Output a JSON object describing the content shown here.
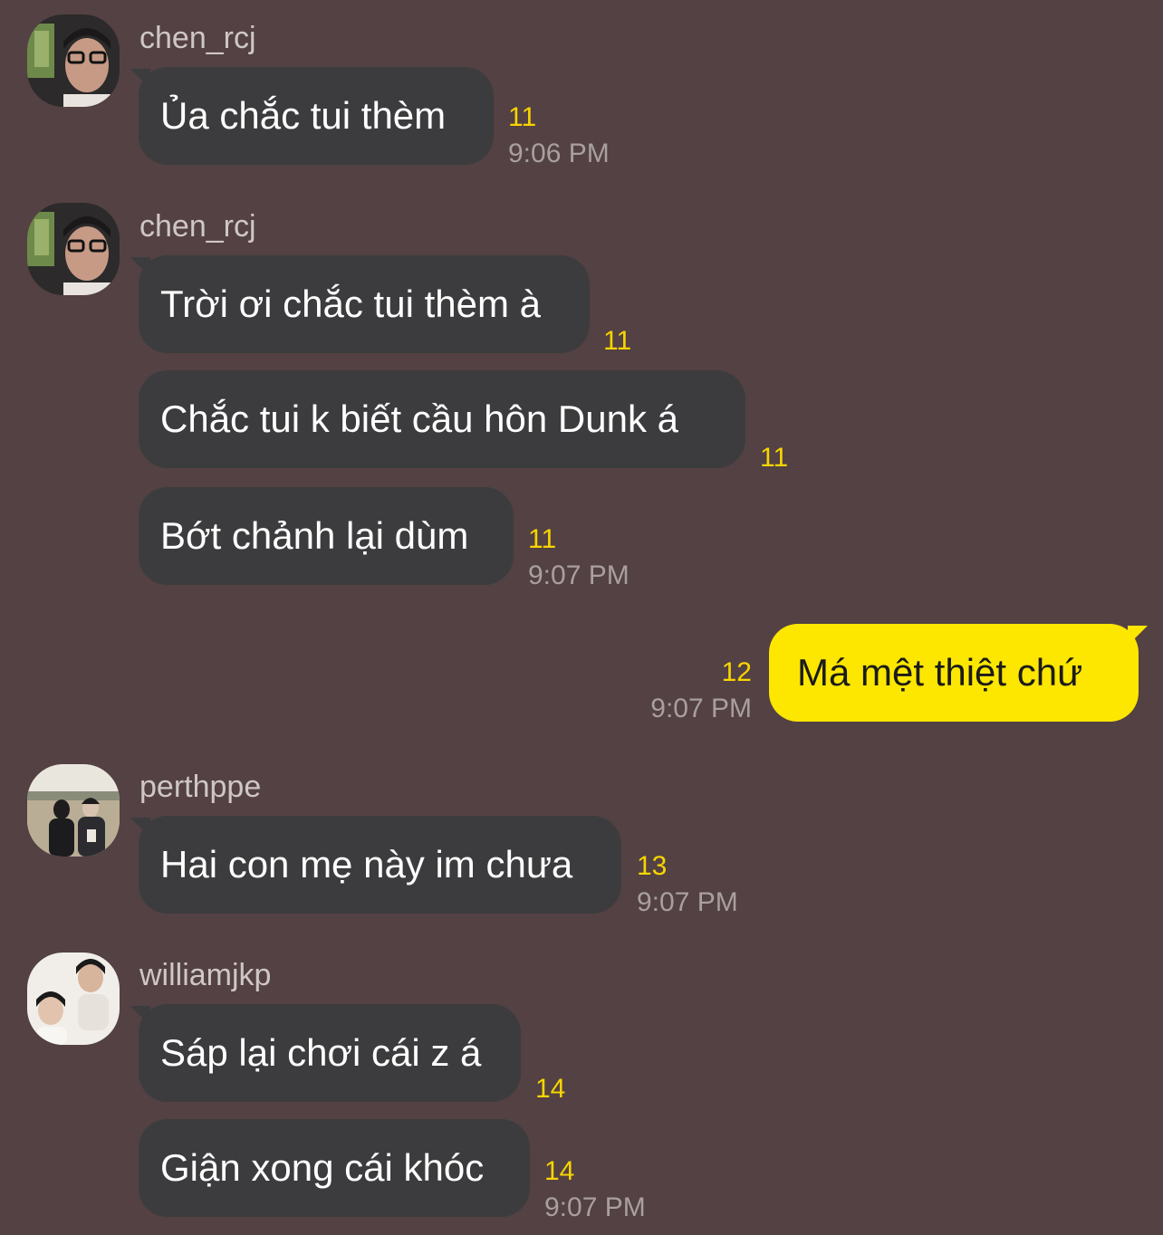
{
  "messages": [
    {
      "sender": "chen_rcj",
      "text": "Ủa chắc tui thèm",
      "unread": "11",
      "time": "9:06 PM"
    },
    {
      "sender": "chen_rcj",
      "text": "Trời ơi chắc tui thèm à",
      "unread": "11"
    },
    {
      "text": "Chắc tui k biết cầu hôn Dunk á",
      "unread": "11"
    },
    {
      "text": "Bớt chảnh lại dùm",
      "unread": "11",
      "time": "9:07 PM"
    },
    {
      "text": "Má mệt thiệt chứ",
      "unread": "12",
      "time": "9:07 PM",
      "outgoing": true
    },
    {
      "sender": "perthppe",
      "text": "Hai con mẹ này im chưa",
      "unread": "13",
      "time": "9:07 PM"
    },
    {
      "sender": "williamjkp",
      "text": "Sáp lại chơi cái z á",
      "unread": "14"
    },
    {
      "text": "Giận xong cái khóc",
      "unread": "14",
      "time": "9:07 PM"
    }
  ],
  "colors": {
    "background": "#534143",
    "incoming_bubble": "#3c3c3e",
    "outgoing_bubble": "#fde600",
    "unread_count": "#f7d500",
    "timestamp": "#a99fa0"
  }
}
